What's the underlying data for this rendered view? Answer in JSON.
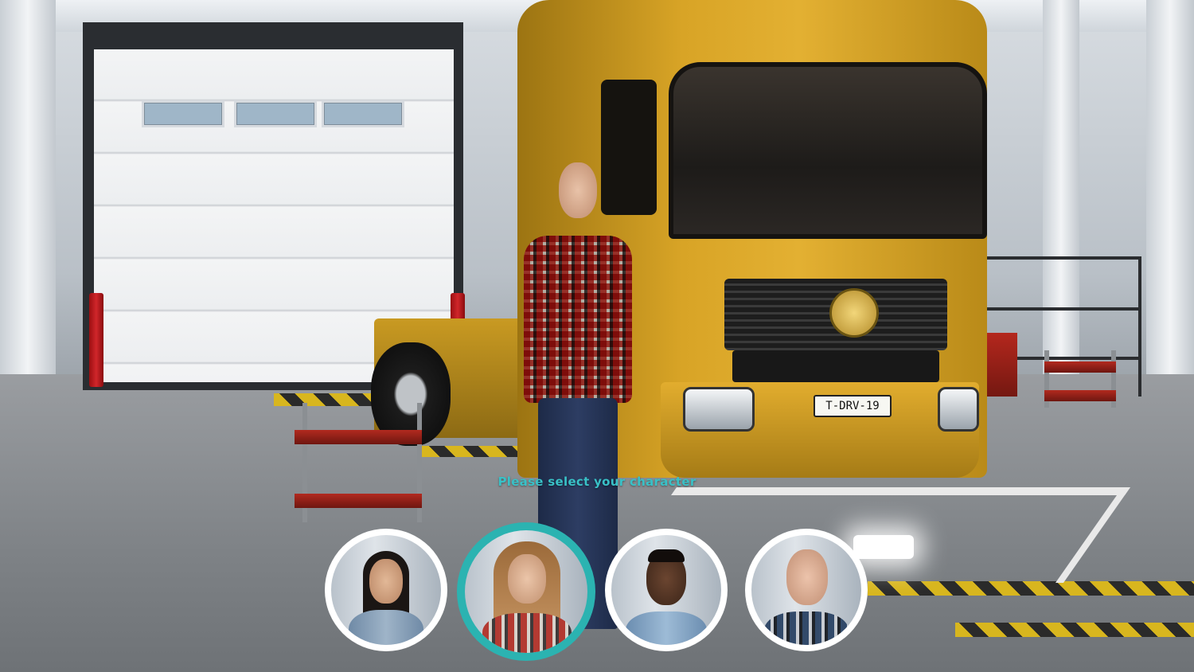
{
  "prompt": {
    "text": "Please select your character",
    "color": "#39c1c7"
  },
  "truck": {
    "plate": "T-DRV-19",
    "body_color": "#d8a426"
  },
  "character_select": {
    "selected_index": 1,
    "selected_ring_color": "#2bb3b1",
    "characters": [
      {
        "id": "character-1",
        "hair": "long dark hair"
      },
      {
        "id": "character-2",
        "hair": "long auburn hair"
      },
      {
        "id": "character-3",
        "hair": "short dark hair"
      },
      {
        "id": "character-4",
        "hair": "bald"
      }
    ]
  }
}
